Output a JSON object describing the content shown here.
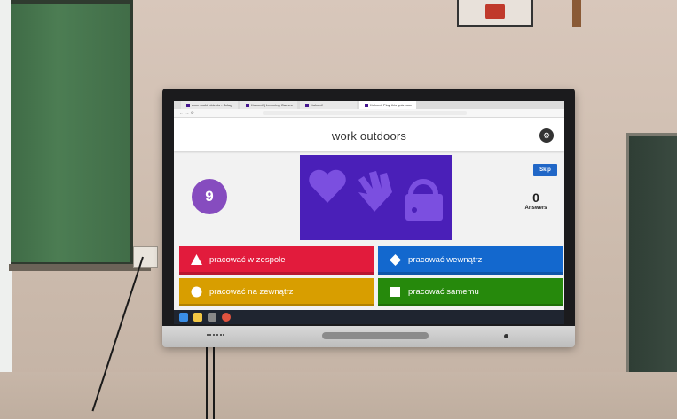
{
  "browser": {
    "tabs": [
      {
        "label": "ecze mobi obiekts - Szlag"
      },
      {
        "label": "Kahoot! | Learning Games"
      },
      {
        "label": "Kahoot!"
      },
      {
        "label": "Kahoot! Play this quiz now"
      }
    ]
  },
  "quiz": {
    "question": "work outdoors",
    "timer": "9",
    "skip_label": "Skip",
    "answers_count": "0",
    "answers_label": "Answers",
    "options": [
      {
        "label": "pracować w zespole",
        "shape": "triangle-icon",
        "color": "#e21b3c"
      },
      {
        "label": "pracować wewnątrz",
        "shape": "diamond-icon",
        "color": "#1368ce"
      },
      {
        "label": "pracować na zewnątrz",
        "shape": "circle-icon",
        "color": "#d89e00"
      },
      {
        "label": "pracować samemu",
        "shape": "square-icon",
        "color": "#26890c"
      }
    ]
  },
  "colors": {
    "timer_purple": "#864cbf",
    "media_bg": "#4a1fb8",
    "skip_blue": "#2167c7"
  }
}
